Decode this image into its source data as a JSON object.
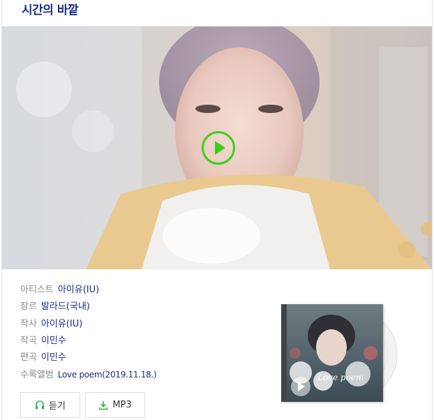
{
  "header": {
    "title": "시간의 바깥"
  },
  "video": {
    "play_icon": "play-icon",
    "accent": "#39d01a"
  },
  "info": {
    "rows": [
      {
        "label": "아티스트",
        "value": "아이유(IU)"
      },
      {
        "label": "장르",
        "value": "발라드(국내)"
      },
      {
        "label": "작사",
        "value": "아이유(IU)"
      },
      {
        "label": "작곡",
        "value": "이민수"
      },
      {
        "label": "편곡",
        "value": "이민수"
      },
      {
        "label": "수록앨범",
        "value": "Love poem(2019.11.18.)"
      }
    ]
  },
  "buttons": {
    "listen": {
      "label": "듣기",
      "icon": "headphones-icon"
    },
    "mp3": {
      "label": "MP3",
      "icon": "download-icon"
    }
  },
  "album": {
    "cover_text": "Love poem",
    "play_icon": "play-icon"
  },
  "colors": {
    "title": "#1a2a8a",
    "label": "#8a8a8a",
    "value": "#1a2a8a",
    "green": "#39d01a"
  }
}
